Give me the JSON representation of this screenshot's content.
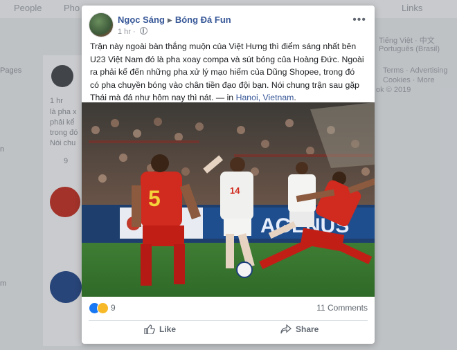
{
  "background": {
    "nav": [
      "People",
      "Pho",
      "Links"
    ],
    "left_snippets": [
      "Pages",
      "1 hr",
      "là pha x",
      "phải kể",
      "trong đó",
      "Nói chu",
      "9",
      "n",
      "m"
    ],
    "right_snippets": [
      "Tiếng Việt · 中文",
      "Português (Brasil)",
      "Terms · Advertising",
      "Cookies · More",
      "ok © 2019"
    ]
  },
  "post": {
    "author": "Ngọc Sáng",
    "page": "Bóng Đá Fun",
    "time": "1 hr",
    "text_before_link": "Trận này ngoài bàn thắng muộn của Việt Hưng thì điểm sáng nhất bên U23 Việt Nam đó là pha xoay compa và sút bóng của Hoàng Đức. Ngoài ra phải kể đến những pha xử lý mạo hiểm của Dũng Shopee, trong đó có pha chuyền bóng vào chân tiền đạo đội bạn. Nói chung trận sau gặp Thái mà đá như hôm nay thì nát. — in ",
    "location": "Hanoi, Vietnam",
    "text_after_link": ".",
    "photo": {
      "player_left_number": "5",
      "player_center_number": "14",
      "board_text": "AGENUS"
    },
    "reactions_count": "9",
    "comments_count": "11 Comments",
    "like_label": "Like",
    "share_label": "Share"
  }
}
